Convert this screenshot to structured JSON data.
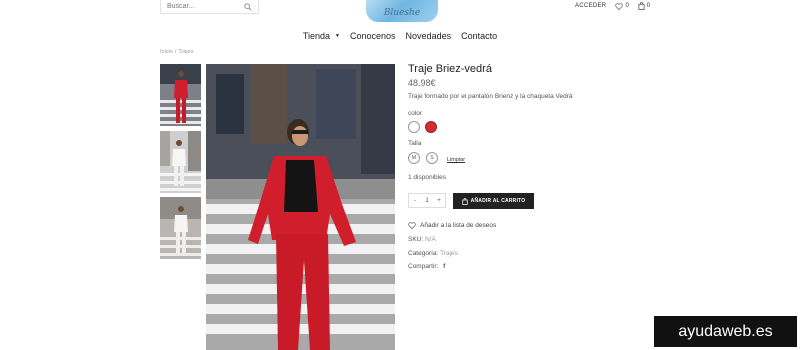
{
  "header": {
    "search_placeholder": "Buscar...",
    "logo_text": "Blueshe",
    "account_label": "ACCEDER",
    "wishlist_count": "0",
    "cart_count": "0"
  },
  "nav": {
    "items": [
      {
        "label": "Tienda"
      },
      {
        "label": "Conocenos"
      },
      {
        "label": "Novedades"
      },
      {
        "label": "Contacto"
      }
    ]
  },
  "breadcrumb": {
    "home": "Inicio",
    "separator": "/",
    "current": "Trajes"
  },
  "product": {
    "title": "Traje Briez-vedrá",
    "price": "48.98€",
    "description": "Traje formado por el pantalón Brienz y la chaqueta Vedrá",
    "color_label": "color",
    "colors": [
      "#ffffff",
      "#d42a34"
    ],
    "size_label": "Talla",
    "sizes": [
      "M",
      "S"
    ],
    "clear_label": "Limpiar",
    "availability": "1 disponibles",
    "quantity": "1",
    "qty_minus": "-",
    "qty_plus": "+",
    "add_to_cart": "AÑADIR AL CARRITO",
    "wishlist": "Añadir a la lista de deseos",
    "sku_label": "SKU:",
    "sku_value": "N/A",
    "category_label": "Categoría:",
    "category_value": "Trajes",
    "share_label": "Compartir:"
  },
  "watermark": "ayudaweb.es"
}
